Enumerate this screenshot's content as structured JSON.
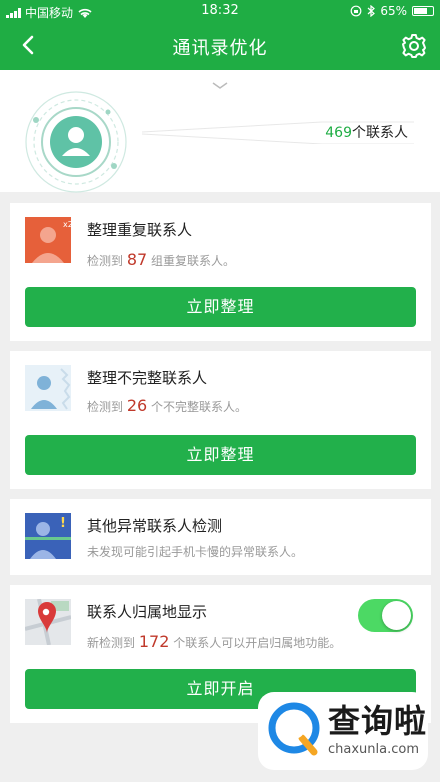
{
  "status_bar": {
    "carrier": "中国移动",
    "time": "18:32",
    "battery": "65%"
  },
  "nav": {
    "title": "通讯录优化",
    "back_icon": "chevron-left-icon",
    "settings_icon": "gear-icon"
  },
  "summary": {
    "count": "469",
    "count_suffix": "个联系人"
  },
  "cards": [
    {
      "title": "整理重复联系人",
      "desc_prefix": "检测到",
      "desc_num": "87",
      "desc_suffix": "组重复联系人。",
      "button": "立即整理",
      "badge": "x2"
    },
    {
      "title": "整理不完整联系人",
      "desc_prefix": "检测到",
      "desc_num": "26",
      "desc_suffix": "个不完整联系人。",
      "button": "立即整理"
    },
    {
      "title": "其他异常联系人检测",
      "desc": "未发现可能引起手机卡慢的异常联系人。"
    },
    {
      "title": "联系人归属地显示",
      "desc_prefix": "新检测到",
      "desc_num": "172",
      "desc_suffix": "个联系人可以开启归属地功能。",
      "button": "立即开启",
      "toggle_on": true
    }
  ],
  "watermark": {
    "cn": "查询啦",
    "en": "chaxunla.com"
  },
  "colors": {
    "brand_green": "#1fad44",
    "button_green": "#22b04b",
    "number_red": "#c0392b",
    "toggle_green": "#4cd964"
  }
}
